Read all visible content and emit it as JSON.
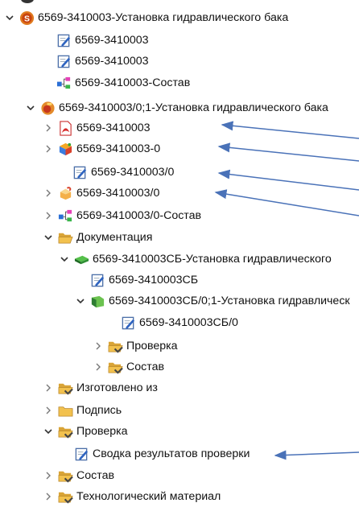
{
  "rows": [
    {
      "label": "6569-3410003-Установка гидравлического бака",
      "icon": "assembly-root-icon",
      "toggle": "open"
    },
    {
      "label": "6569-3410003",
      "icon": "document-edit-icon",
      "toggle": "none"
    },
    {
      "label": "6569-3410003",
      "icon": "document-edit-icon",
      "toggle": "none"
    },
    {
      "label": "6569-3410003-Состав",
      "icon": "structure-icon",
      "toggle": "none"
    },
    {
      "label": "6569-3410003/0;1-Установка гидравлического бака",
      "icon": "assembly-revision-icon",
      "toggle": "open"
    },
    {
      "label": "6569-3410003",
      "icon": "pdf-icon",
      "toggle": "closed"
    },
    {
      "label": "6569-3410003-0",
      "icon": "cube-model-icon",
      "toggle": "closed"
    },
    {
      "label": "6569-3410003/0",
      "icon": "document-edit-icon",
      "toggle": "none"
    },
    {
      "label": "6569-3410003/0",
      "icon": "part-orange-icon",
      "toggle": "closed"
    },
    {
      "label": "6569-3410003/0-Состав",
      "icon": "structure-icon",
      "toggle": "closed"
    },
    {
      "label": "Документация",
      "icon": "folder-open-icon",
      "toggle": "open"
    },
    {
      "label": "6569-3410003СБ-Установка гидравлического",
      "icon": "drawing-green-icon",
      "toggle": "open"
    },
    {
      "label": "6569-3410003СБ",
      "icon": "document-edit-icon",
      "toggle": "none"
    },
    {
      "label": "6569-3410003СБ/0;1-Установка гидравлическ",
      "icon": "drawing-revision-icon",
      "toggle": "open"
    },
    {
      "label": "6569-3410003СБ/0",
      "icon": "document-edit-icon",
      "toggle": "none"
    },
    {
      "label": "Проверка",
      "icon": "folder-check-icon",
      "toggle": "closed"
    },
    {
      "label": "Состав",
      "icon": "folder-check-icon",
      "toggle": "closed"
    },
    {
      "label": "Изготовлено из",
      "icon": "folder-check-icon",
      "toggle": "closed"
    },
    {
      "label": "Подпись",
      "icon": "folder-icon",
      "toggle": "closed"
    },
    {
      "label": "Проверка",
      "icon": "folder-check-icon",
      "toggle": "open"
    },
    {
      "label": "Сводка результатов проверки",
      "icon": "document-edit-icon",
      "toggle": "none"
    },
    {
      "label": "Состав",
      "icon": "folder-check-icon",
      "toggle": "closed"
    },
    {
      "label": "Технологический материал",
      "icon": "folder-check-icon",
      "toggle": "closed"
    }
  ],
  "colors": {
    "arrow": "#4a72b8",
    "folder": "#f2c14e",
    "pdf": "#d62b2b",
    "green": "#3aa335"
  }
}
